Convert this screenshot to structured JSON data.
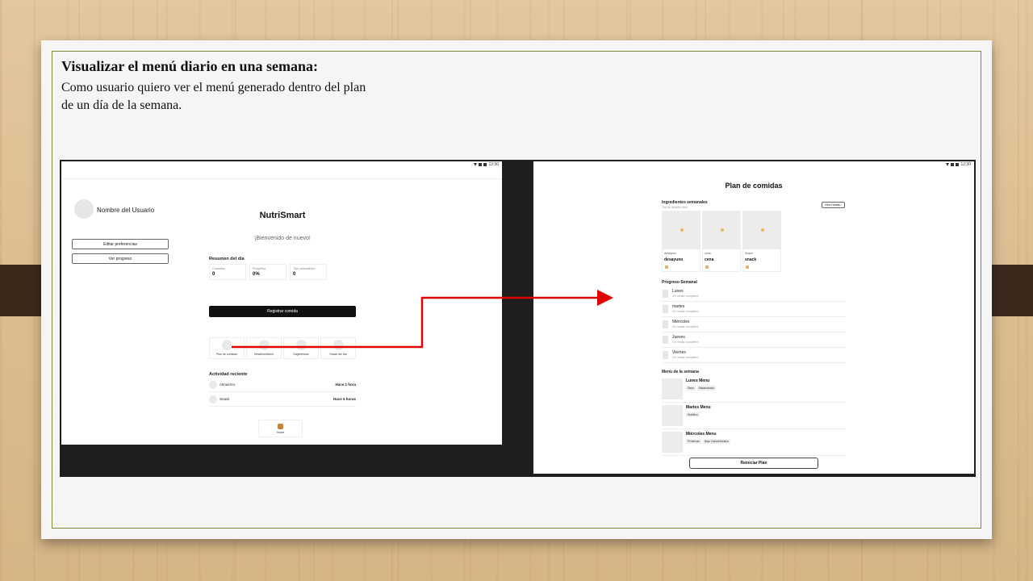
{
  "slide": {
    "title": "Visualizar el menú diario en una semana:",
    "body": "Como usuario quiero ver el menú generado dentro del plan de un día de la semana."
  },
  "left_screen": {
    "status_time": "12:30",
    "user_name": "Nombre del Usuario",
    "edit_prefs": "Editar preferencias",
    "view_progress": "Ver progreso",
    "app_name": "NutriSmart",
    "welcome": "¡Bienvenido de nuevo!",
    "summary_title": "Resumen del día",
    "stats": [
      {
        "label": "Comidas",
        "value": "0"
      },
      {
        "label": "Progreso",
        "value": "0%"
      },
      {
        "label": "Tips saludables",
        "value": "0"
      }
    ],
    "register_meal": "Registrar comida",
    "quick_actions": [
      "Plan de comidas",
      "Desafíos/ésimo",
      "Sugerencias",
      "Snack del día"
    ],
    "activity_title": "Actividad reciente",
    "activities": [
      {
        "name": "Almuerzo",
        "time": "Hace 1 hora"
      },
      {
        "name": "Snack",
        "time": "Hace 5 horas"
      }
    ],
    "home_label": "Home",
    "home_icon": "home-icon"
  },
  "right_screen": {
    "status_time": "12:30",
    "title": "Plan de comidas",
    "ingredients_title": "Ingredientes semanales",
    "ingredients_hint": "Tap for detailed view",
    "view_details": "View Details",
    "ingredients": [
      {
        "category": "desayuno",
        "name": "desayuno"
      },
      {
        "category": "cena",
        "name": "cena"
      },
      {
        "category": "Snack",
        "name": "snack"
      }
    ],
    "progress_title": "Progreso Semanal",
    "days": [
      {
        "name": "Lunes",
        "status": "4/4 meals completed"
      },
      {
        "name": "martes",
        "status": "4/4 meals completed"
      },
      {
        "name": "Miércoles",
        "status": "4/4 meals completed"
      },
      {
        "name": "Jueves",
        "status": "1/4 meals completed"
      },
      {
        "name": "Viernes",
        "status": "0/4 meals completed"
      }
    ],
    "menu_title": "Menu de la semana",
    "menus": [
      {
        "name": "Lunes Menu",
        "tags": [
          "Sano",
          "Balanceado"
        ]
      },
      {
        "name": "Martes Menu",
        "tags": [
          "Nutritivo"
        ]
      },
      {
        "name": "Miércoles Menu",
        "tags": [
          "Proteínas",
          "Bajo Carbohidratos"
        ]
      }
    ],
    "reset_plan": "Reiniciar Plan"
  },
  "colors": {
    "accent_arrow": "#e00000",
    "slide_border": "#7a8d3b",
    "primary_button": "#111111"
  }
}
